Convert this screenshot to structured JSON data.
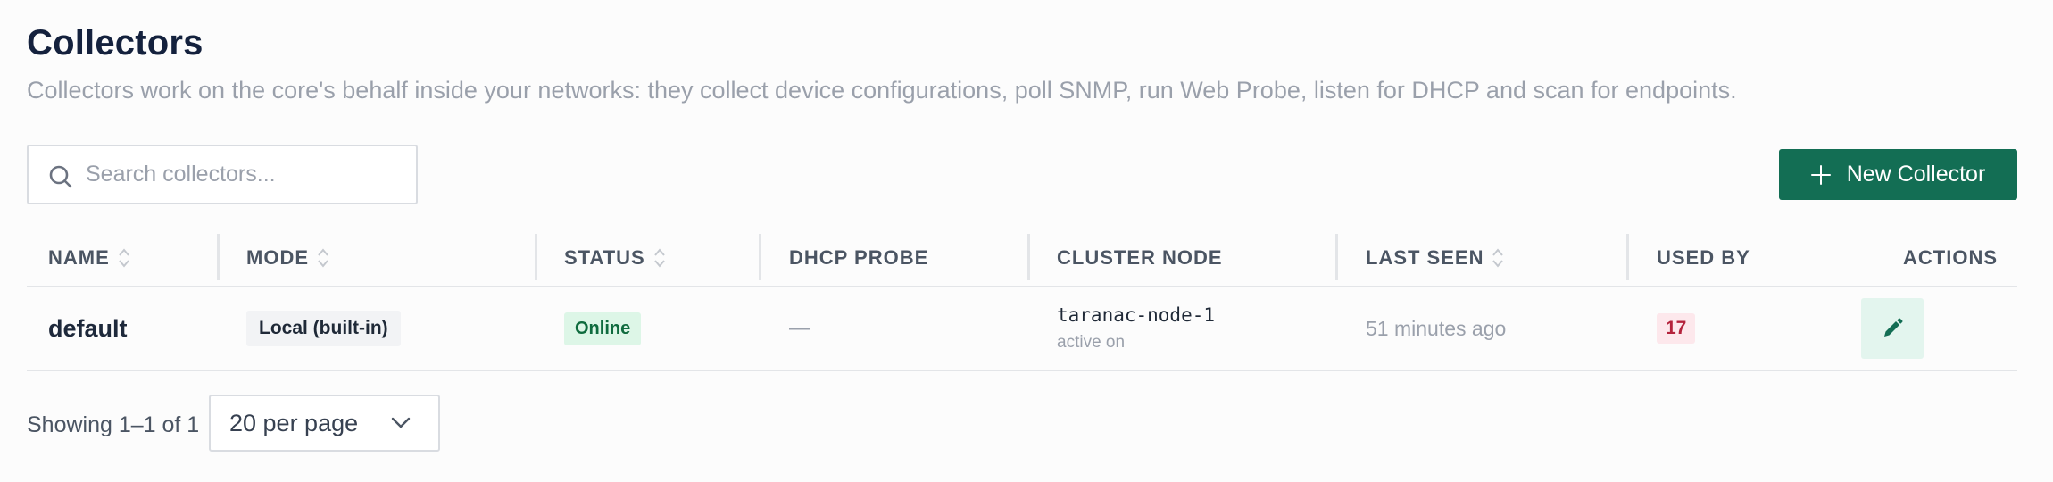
{
  "header": {
    "title": "Collectors",
    "subtitle": "Collectors work on the core's behalf inside your networks: they collect device configurations, poll SNMP, run Web Probe, listen for DHCP and scan for endpoints."
  },
  "search": {
    "placeholder": "Search collectors...",
    "value": "",
    "icon": "search-icon"
  },
  "new_button": {
    "label": "New Collector",
    "icon": "plus-icon",
    "color": "#136e54"
  },
  "table": {
    "columns": [
      {
        "label": "NAME",
        "sortable": true
      },
      {
        "label": "MODE",
        "sortable": true
      },
      {
        "label": "STATUS",
        "sortable": true
      },
      {
        "label": "DHCP PROBE",
        "sortable": false
      },
      {
        "label": "CLUSTER NODE",
        "sortable": false
      },
      {
        "label": "LAST SEEN",
        "sortable": true
      },
      {
        "label": "USED BY",
        "sortable": false
      },
      {
        "label": "ACTIONS",
        "sortable": false
      }
    ],
    "rows": [
      {
        "name": "default",
        "mode": "Local (built-in)",
        "status": "Online",
        "dhcp_probe": "—",
        "cluster_node": "taranac-node-1",
        "cluster_node_state": "active on",
        "last_seen": "51 minutes ago",
        "used_by": "17",
        "action_icon": "pencil-icon"
      }
    ]
  },
  "footer": {
    "showing": "Showing 1–1 of 1",
    "per_page": "20 per page"
  },
  "colors": {
    "accent": "#136e54",
    "status_online_bg": "#ddf6e7",
    "status_online_text": "#0f6b3e",
    "used_by_bg": "#fde8ec",
    "used_by_text": "#b4233c"
  }
}
